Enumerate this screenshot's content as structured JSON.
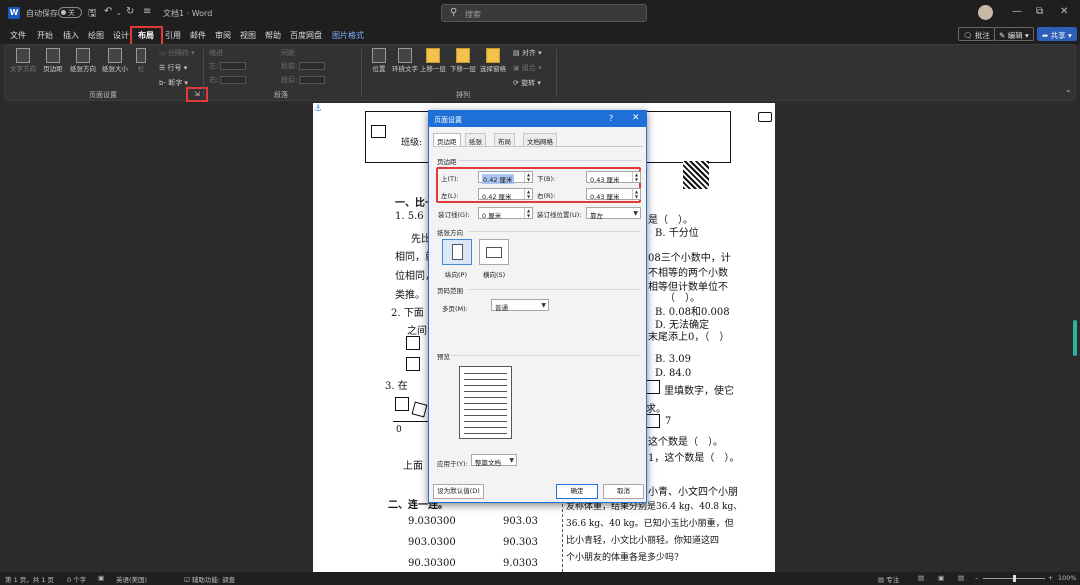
{
  "titlebar": {
    "autosave_label": "自动保存",
    "autosave_state": "关",
    "doc_title": "文档1 · Word",
    "search_placeholder": "搜索"
  },
  "menu": {
    "tabs": [
      "文件",
      "开始",
      "插入",
      "绘图",
      "设计",
      "布局",
      "引用",
      "邮件",
      "审阅",
      "视图",
      "帮助",
      "百度网盘",
      "图片格式"
    ],
    "active_tab": "布局",
    "right_buttons": {
      "comment": "批注",
      "edit": "编辑",
      "share": "共享"
    }
  },
  "ribbon": {
    "page_setup": {
      "title": "页面设置",
      "buttons": [
        "文字方向",
        "页边距",
        "纸张方向",
        "纸张大小",
        "栏"
      ],
      "small": {
        "breaks": "分隔符",
        "line_numbers": "行号",
        "hyphenation": "断字"
      }
    },
    "paragraph": {
      "title": "段落",
      "indent_label": "缩进",
      "spacing_label": "间距",
      "left": "左:",
      "right": "右:",
      "before": "段前:",
      "after": "段后:",
      "indent_left_val": "0 字符",
      "indent_right_val": "0 字符",
      "space_before_val": "0 行",
      "space_after_val": "0 行"
    },
    "arrange": {
      "title": "排列",
      "buttons": [
        "位置",
        "环绕文字",
        "上移一层",
        "下移一层",
        "选择窗格"
      ],
      "small": {
        "align": "对齐",
        "group": "组合",
        "rotate": "旋转"
      }
    }
  },
  "document": {
    "lines_left": [
      {
        "text": "班级:",
        "bold": false
      },
      {
        "text": "一、比一",
        "bold": true
      },
      {
        "text": "1.  5.6",
        "bold": false
      },
      {
        "text": "先比",
        "bold": false
      },
      {
        "text": "相同，就",
        "bold": false
      },
      {
        "text": "位相同，",
        "bold": false
      },
      {
        "text": "类推。",
        "bold": false
      },
      {
        "text": "2.  下面",
        "bold": false
      },
      {
        "text": "之间",
        "bold": false
      },
      {
        "text": "3.  在",
        "bold": false
      },
      {
        "text": "0",
        "bold": false
      },
      {
        "text": "上面",
        "bold": false
      },
      {
        "text": "二、连一连。",
        "bold": true
      }
    ],
    "match_left": [
      "9.030300",
      "903.0300",
      "90.30300"
    ],
    "match_right": [
      "903.03",
      "90.303",
      "9.0303"
    ],
    "lines_right": [
      {
        "text": "是（　）。"
      },
      {
        "text": "B.  千分位"
      },
      {
        "text": "08三个小数中，计"
      },
      {
        "text": "不相等的两个小数"
      },
      {
        "text": "相等但计数单位不"
      },
      {
        "text": "（　）。"
      },
      {
        "text": "B.  0.08和0.008"
      },
      {
        "text": "D.  无法确定"
      },
      {
        "text": "末尾添上0，（　）"
      },
      {
        "text": "B.  3.09"
      },
      {
        "text": "D.  84.0"
      },
      {
        "text": "里填数字，使它"
      },
      {
        "text": "求。"
      },
      {
        "text": "7"
      },
      {
        "text": "这个数是（　）。"
      },
      {
        "text": "1，这个数是（　）。"
      },
      {
        "text": "小青、小文四个小朋"
      },
      {
        "text": "友称体重，结果分别是36.4 kg、40.8 kg、"
      },
      {
        "text": "36.6 kg、40 kg。已知小玉比小丽重，但"
      },
      {
        "text": "比小青轻，小文比小丽轻。你知道这四"
      },
      {
        "text": "个小朋友的体重各是多少吗?"
      }
    ]
  },
  "dialog": {
    "title": "页面设置",
    "help": "?",
    "tabs": [
      "页边距",
      "纸张",
      "布局",
      "文档网格"
    ],
    "active_tab": "页边距",
    "margins_section": "页边距",
    "top_label": "上(T):",
    "top_value": "0.42 厘米",
    "bottom_label": "下(B):",
    "bottom_value": "0.43 厘米",
    "left_label": "左(L):",
    "left_value": "0.42 厘米",
    "right_label": "右(R):",
    "right_value": "0.43 厘米",
    "gutter_label": "装订线(G):",
    "gutter_value": "0 厘米",
    "gutter_pos_label": "装订线位置(U):",
    "gutter_pos_value": "靠左",
    "orientation_section": "纸张方向",
    "portrait": "纵向(P)",
    "landscape": "横向(S)",
    "pages_section": "页码范围",
    "multiple_pages_label": "多页(M):",
    "multiple_pages_value": "普通",
    "preview_section": "预览",
    "apply_to_label": "应用于(Y):",
    "apply_to_value": "整篇文档",
    "set_default": "设为默认值(D)",
    "ok": "确定",
    "cancel": "取消"
  },
  "statusbar": {
    "page": "第 1 页，共 1 页",
    "words": "0 个字",
    "language": "英语(美国)",
    "accessibility": "辅助功能: 调查",
    "focus": "专注",
    "zoom": "100%"
  }
}
